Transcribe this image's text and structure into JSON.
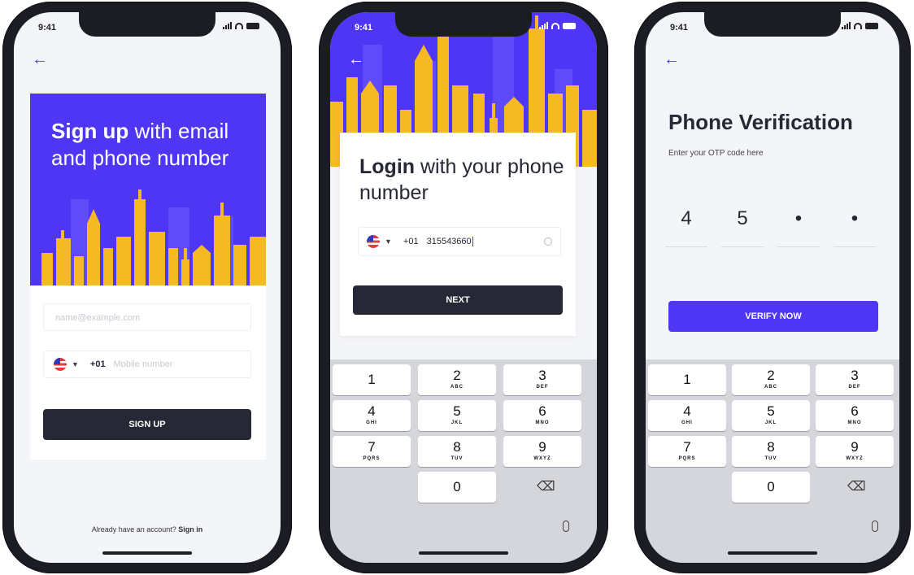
{
  "colors": {
    "accent": "#4f36f5",
    "dark": "#262935",
    "building": "#f5b923"
  },
  "status": {
    "time": "9:41"
  },
  "signup": {
    "title_bold": "Sign up",
    "title_rest": " with email and phone number",
    "email_placeholder": "name@example.com",
    "country_code": "+01",
    "mobile_placeholder": "Mobile number",
    "button": "SIGN UP",
    "footer_text": "Already have an account?",
    "footer_link": "Sign in"
  },
  "login": {
    "title_bold": "Login",
    "title_rest": " with your phone number",
    "country_code": "+01",
    "phone_value": "315543660",
    "button": "NEXT"
  },
  "verify": {
    "title": "Phone Verification",
    "subtitle": "Enter your OTP code here",
    "otp": [
      "4",
      "5",
      "•",
      "•"
    ],
    "button": "VERIFY NOW"
  },
  "keypad": [
    {
      "num": "1",
      "letters": ""
    },
    {
      "num": "2",
      "letters": "ABC"
    },
    {
      "num": "3",
      "letters": "DEF"
    },
    {
      "num": "4",
      "letters": "GHI"
    },
    {
      "num": "5",
      "letters": "JKL"
    },
    {
      "num": "6",
      "letters": "MNO"
    },
    {
      "num": "7",
      "letters": "PQRS"
    },
    {
      "num": "8",
      "letters": "TUV"
    },
    {
      "num": "9",
      "letters": "WXYZ"
    },
    {
      "num": "0",
      "letters": ""
    }
  ],
  "icons": [
    "back-arrow-icon",
    "us-flag-icon",
    "dropdown-caret-icon",
    "clear-icon",
    "delete-key-icon",
    "microphone-icon",
    "signal-icon",
    "wifi-icon",
    "battery-icon"
  ]
}
